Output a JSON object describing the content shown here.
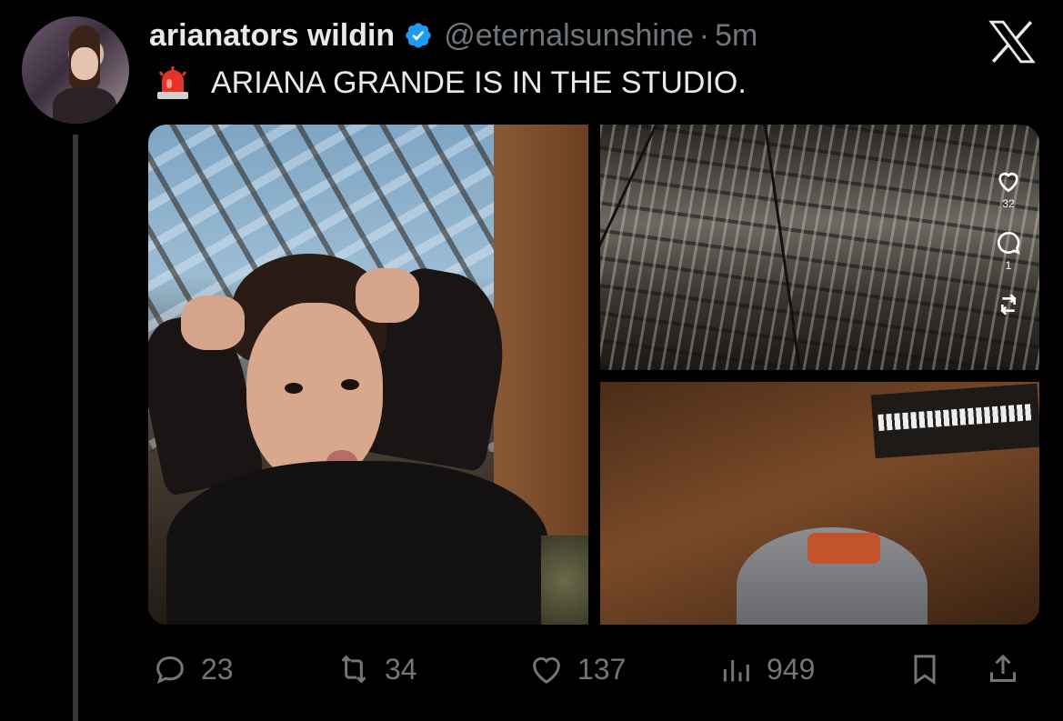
{
  "author": {
    "display_name": "arianators wildin",
    "handle": "@eternalsunshine",
    "separator": "·",
    "time": "5m",
    "verified": true
  },
  "tweet": {
    "emoji": "siren-icon",
    "text": "ARIANA GRANDE IS IN THE STUDIO."
  },
  "media": {
    "count": 3,
    "overlay_actions": {
      "like_count": "32",
      "comment_count": "1"
    }
  },
  "actions": {
    "replies": "23",
    "reposts": "34",
    "likes": "137",
    "views": "949"
  },
  "colors": {
    "background": "#000000",
    "text": "#e7e9ea",
    "muted": "#71767b",
    "verified": "#1d9bf0"
  }
}
